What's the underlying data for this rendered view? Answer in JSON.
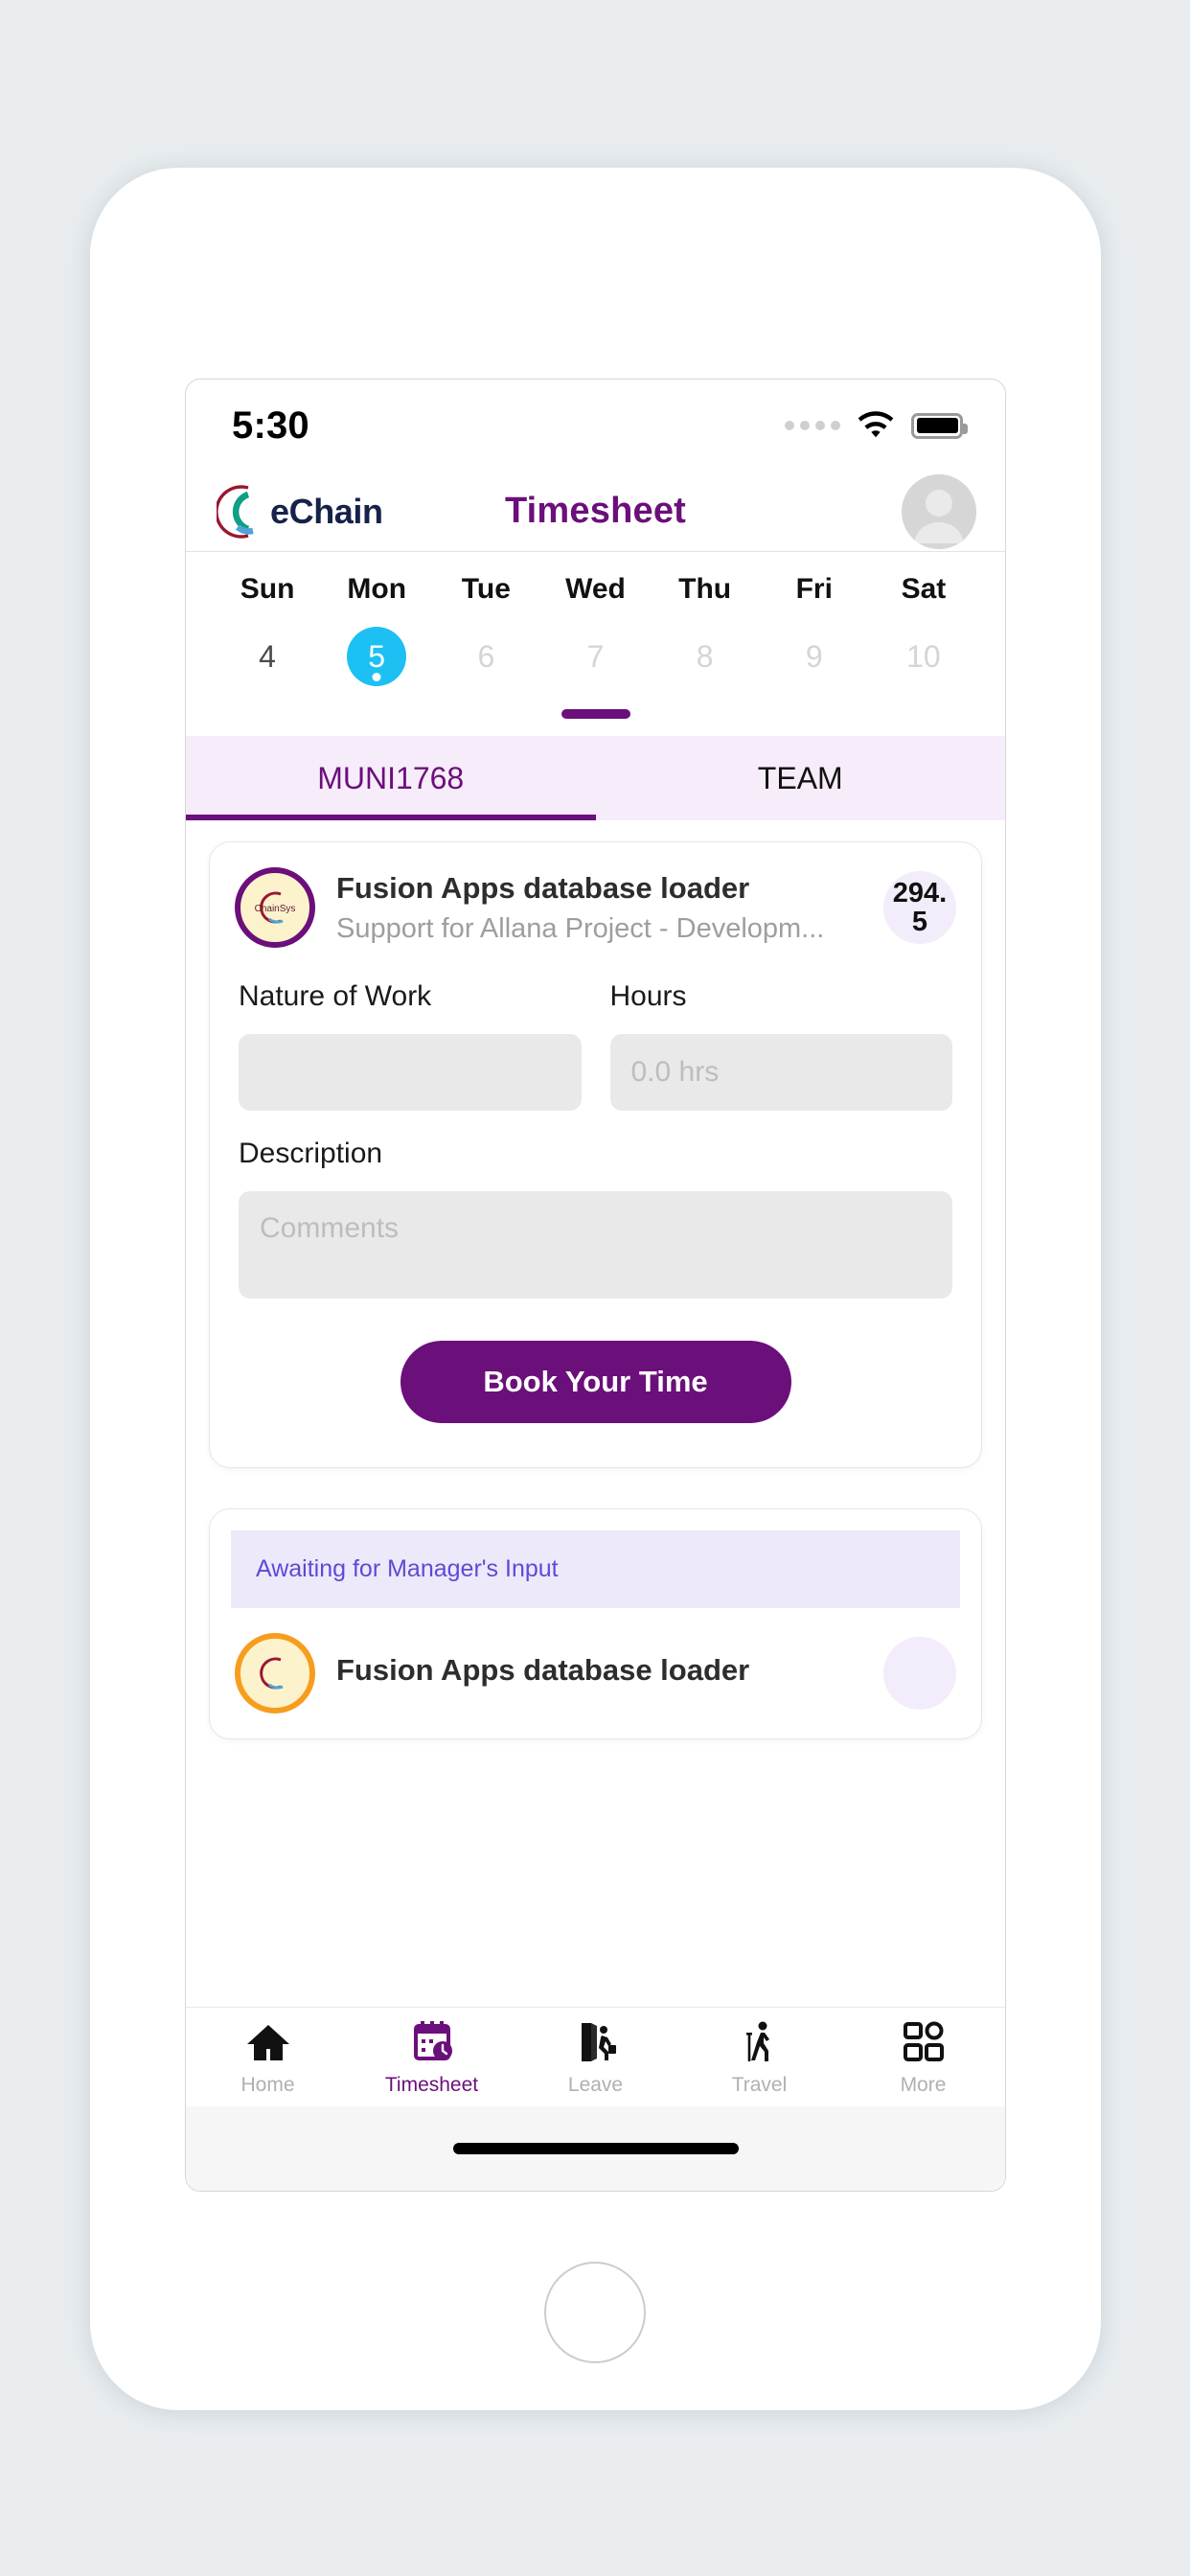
{
  "statusbar": {
    "time": "5:30",
    "signal_icon": "signal-dots-icon",
    "wifi_icon": "wifi-icon",
    "battery_icon": "battery-full-icon"
  },
  "header": {
    "logo_text": "eChain",
    "logo_icon": "echain-logo-icon",
    "title": "Timesheet",
    "avatar_icon": "user-avatar-icon"
  },
  "week": {
    "days": [
      {
        "name": "Sun",
        "num": "4",
        "state": "normal"
      },
      {
        "name": "Mon",
        "num": "5",
        "state": "active"
      },
      {
        "name": "Tue",
        "num": "6",
        "state": "muted"
      },
      {
        "name": "Wed",
        "num": "7",
        "state": "muted"
      },
      {
        "name": "Thu",
        "num": "8",
        "state": "muted"
      },
      {
        "name": "Fri",
        "num": "9",
        "state": "muted"
      },
      {
        "name": "Sat",
        "num": "10",
        "state": "muted"
      }
    ],
    "selected_color": "#1dc0f2",
    "handle_color": "#6b0f7a"
  },
  "tabs": [
    {
      "label": "MUNI1768",
      "active": true
    },
    {
      "label": "TEAM",
      "active": false
    }
  ],
  "cards": [
    {
      "avatar_icon": "chainsys-logo-icon",
      "avatar_border": "#6b0f7a",
      "title": "Fusion Apps database loader",
      "subtitle": "Support for Allana Project - Developm...",
      "hours_badge": "294.5"
    },
    {
      "status_banner": "Awaiting for Manager's Input",
      "avatar_icon": "chainsys-logo-icon",
      "avatar_border": "#f79d1e",
      "title": "Fusion Apps database loader"
    }
  ],
  "form": {
    "nature_label": "Nature of Work",
    "nature_value": "",
    "nature_placeholder": "",
    "hours_label": "Hours",
    "hours_value": "",
    "hours_placeholder": "0.0 hrs",
    "description_label": "Description",
    "description_value": "",
    "description_placeholder": "Comments",
    "submit_label": "Book Your Time"
  },
  "bottom_nav": [
    {
      "label": "Home",
      "icon": "home-icon",
      "active": false
    },
    {
      "label": "Timesheet",
      "icon": "calendar-clock-icon",
      "active": true
    },
    {
      "label": "Leave",
      "icon": "door-exit-icon",
      "active": false
    },
    {
      "label": "Travel",
      "icon": "traveler-icon",
      "active": false
    },
    {
      "label": "More",
      "icon": "grid-icon",
      "active": false
    }
  ],
  "colors": {
    "brand_purple": "#6b0f7a",
    "accent_cyan": "#1dc0f2",
    "tab_bg": "#f7ecfa",
    "status_banner_bg": "#eee8fb",
    "status_banner_text": "#5b4bd6",
    "page_bg": "#e9edf0"
  }
}
